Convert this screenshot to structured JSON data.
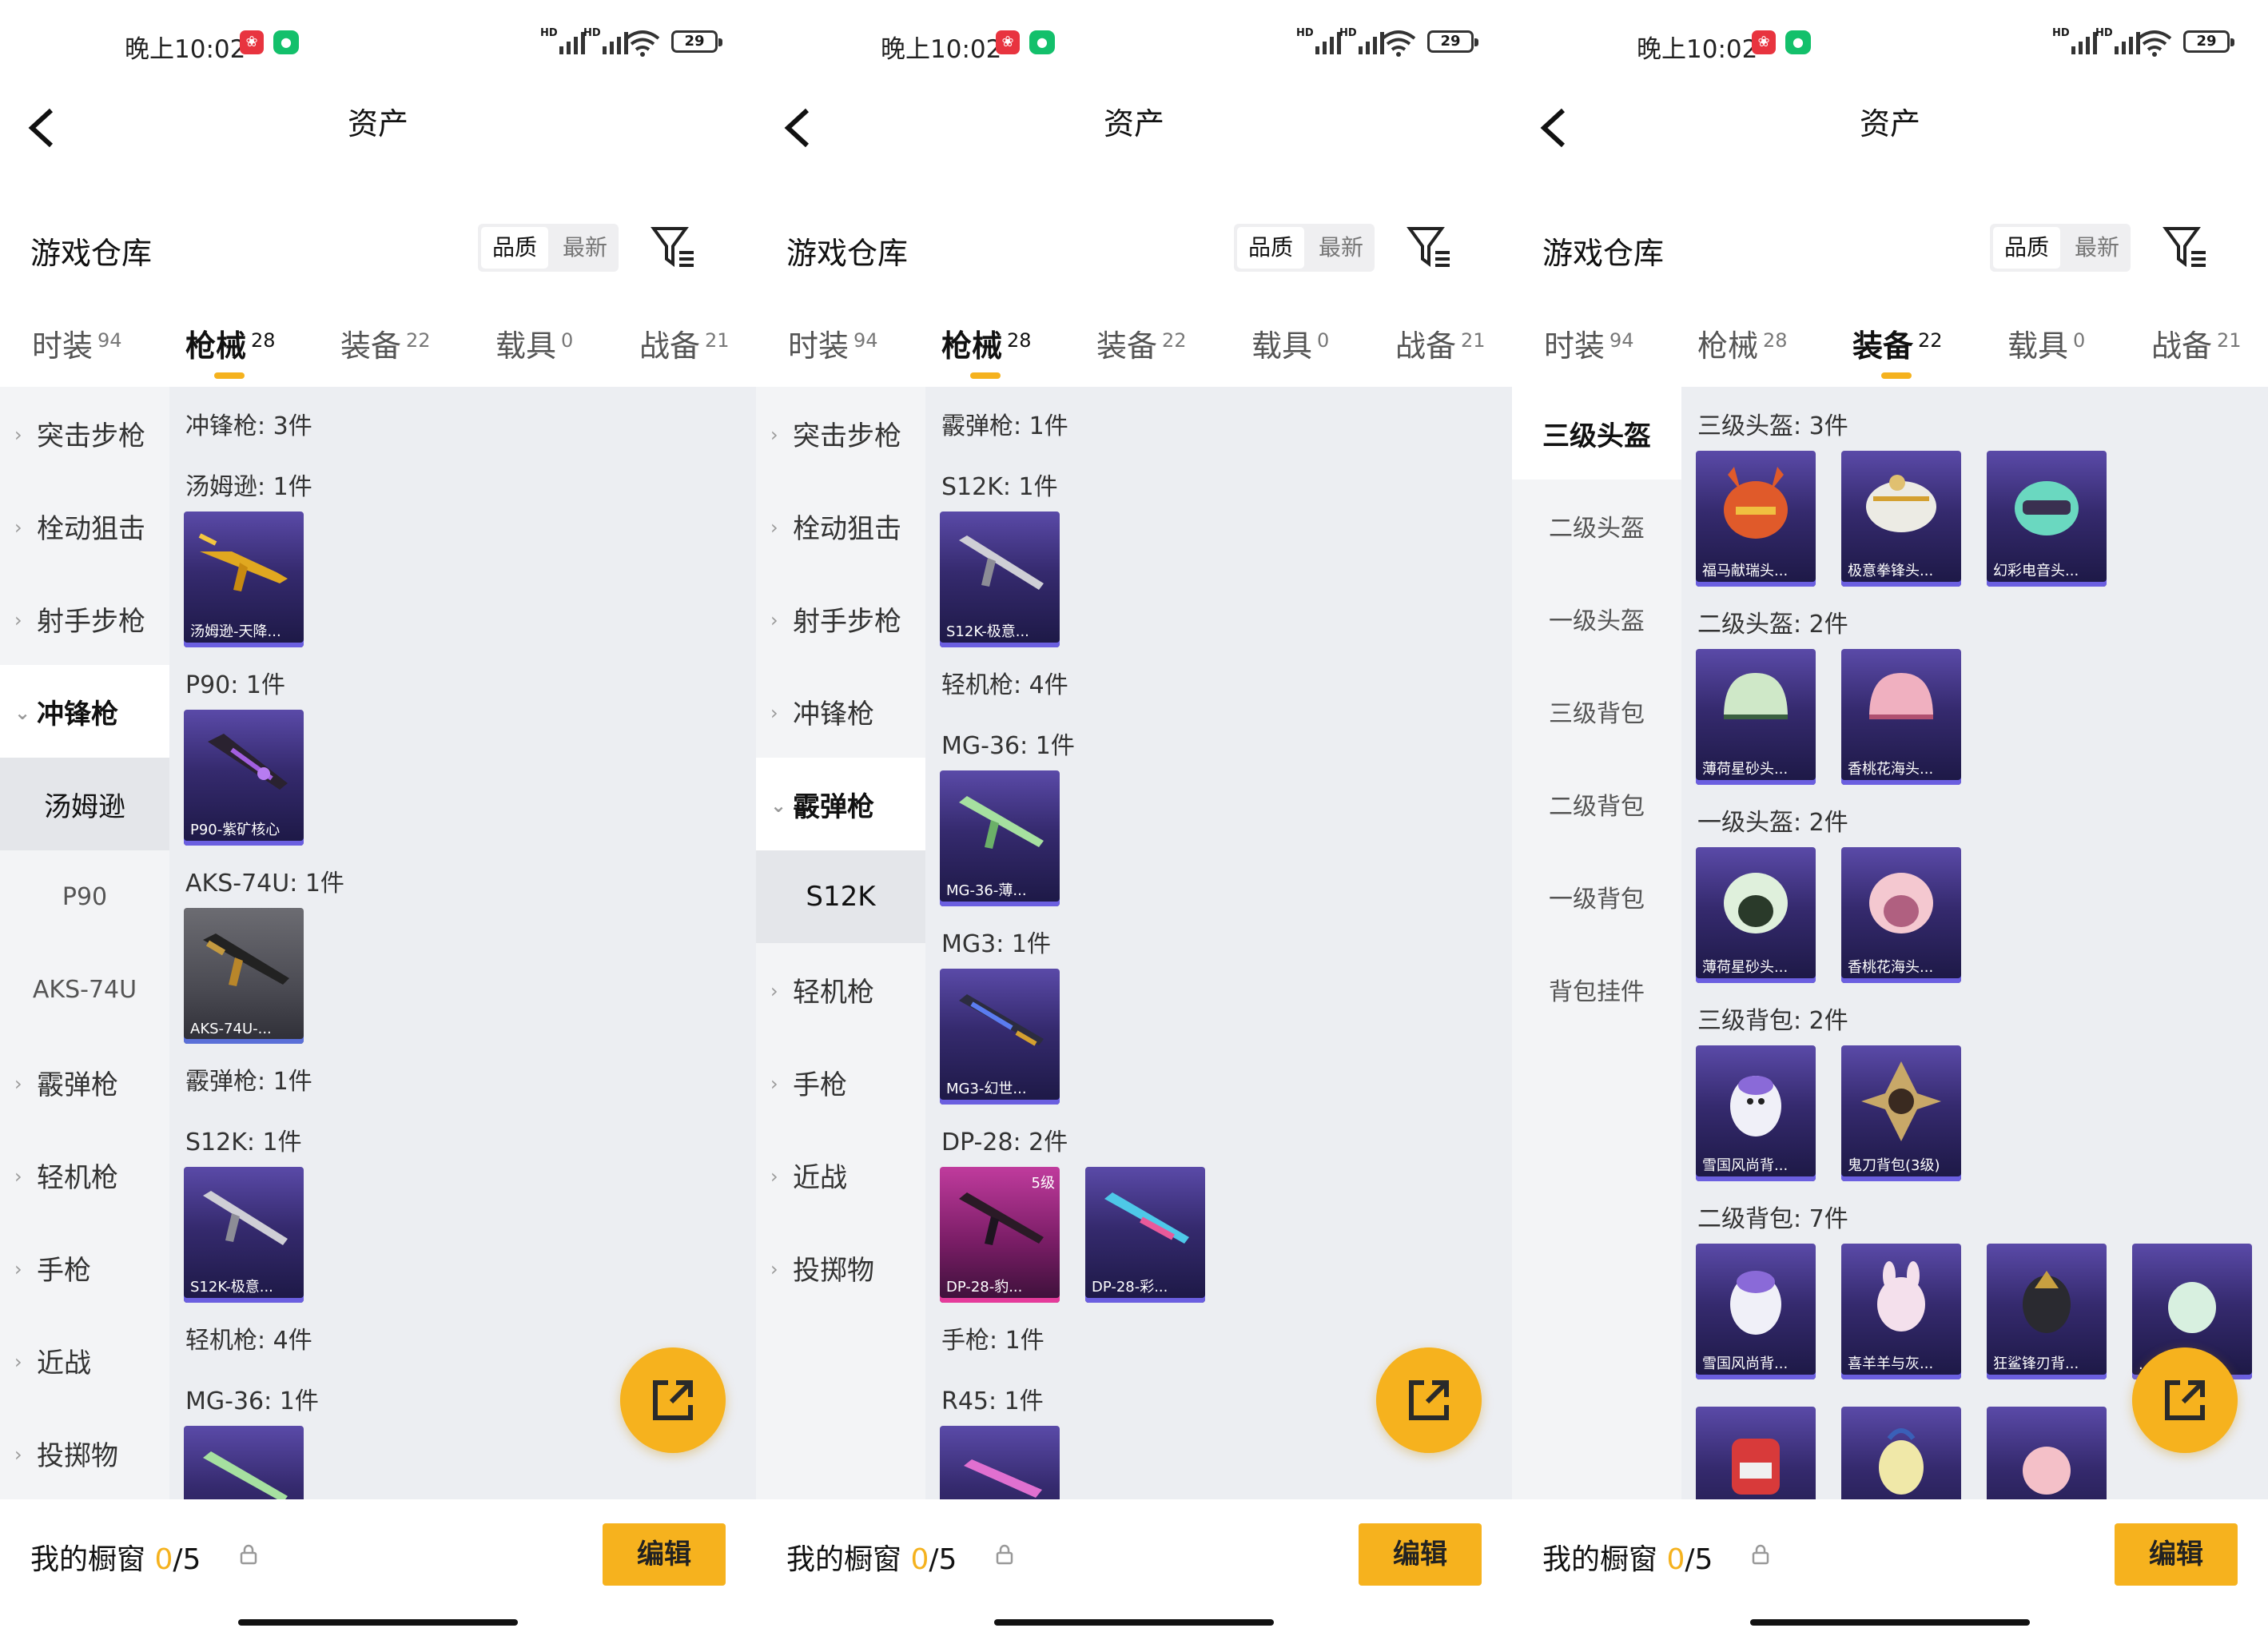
{
  "colors": {
    "accent": "#f6b21e",
    "card_purple": "#352a6e",
    "card_gray": "#4a4a52",
    "card_pink": "#7a1d66",
    "content_bg": "#eceef2"
  },
  "icons": [
    "back-arrow-icon",
    "filter-icon",
    "share-external-icon",
    "lock-icon",
    "wifi-icon",
    "signal-icon",
    "battery-icon",
    "chevron-right-icon",
    "chevron-down-icon"
  ],
  "panels": [
    {
      "status": {
        "time": "晚上10:02",
        "battery": "29",
        "hd1": "HD",
        "hd2": "HD"
      },
      "title": "资产",
      "warehouse": "游戏仓库",
      "sort": [
        "品质",
        "最新"
      ],
      "tabs": [
        {
          "label": "时装",
          "count": "94"
        },
        {
          "label": "枪械",
          "count": "28"
        },
        {
          "label": "装备",
          "count": "22"
        },
        {
          "label": "载具",
          "count": "0"
        },
        {
          "label": "战备",
          "count": "21"
        }
      ],
      "side": [
        "突击步枪",
        "栓动狙击",
        "射手步枪",
        "冲锋枪",
        "汤姆逊",
        "P90",
        "AKS-74U",
        "霰弹枪",
        "轻机枪",
        "手枪",
        "近战",
        "投掷物"
      ],
      "sections": [
        "冲锋枪: 3件",
        "汤姆逊: 1件",
        "P90: 1件",
        "AKS-74U: 1件",
        "霰弹枪: 1件",
        "S12K: 1件",
        "轻机枪: 4件",
        "MG-36: 1件"
      ],
      "cards": [
        "汤姆逊-天降...",
        "P90-紫矿核心",
        "AKS-74U-...",
        "S12K-极意...",
        ""
      ],
      "bottom": {
        "label": "我的橱窗",
        "zero": "0",
        "total": "/5",
        "edit": "编辑"
      }
    },
    {
      "status": {
        "time": "晚上10:02",
        "battery": "29",
        "hd1": "HD",
        "hd2": "HD"
      },
      "title": "资产",
      "warehouse": "游戏仓库",
      "sort": [
        "品质",
        "最新"
      ],
      "tabs": [
        {
          "label": "时装",
          "count": "94"
        },
        {
          "label": "枪械",
          "count": "28"
        },
        {
          "label": "装备",
          "count": "22"
        },
        {
          "label": "载具",
          "count": "0"
        },
        {
          "label": "战备",
          "count": "21"
        }
      ],
      "side": [
        "突击步枪",
        "栓动狙击",
        "射手步枪",
        "冲锋枪",
        "霰弹枪",
        "S12K",
        "轻机枪",
        "手枪",
        "近战",
        "投掷物"
      ],
      "sections": [
        "霰弹枪: 1件",
        "S12K: 1件",
        "轻机枪: 4件",
        "MG-36: 1件",
        "MG3: 1件",
        "DP-28: 2件",
        "手枪: 1件",
        "R45: 1件"
      ],
      "cards": [
        "S12K-极意...",
        "MG-36-薄...",
        "MG3-幻世...",
        "DP-28-豹...",
        "DP-28-彩...",
        ""
      ],
      "level_badge": "5级",
      "bottom": {
        "label": "我的橱窗",
        "zero": "0",
        "total": "/5",
        "edit": "编辑"
      }
    },
    {
      "status": {
        "time": "晚上10:02",
        "battery": "29",
        "hd1": "HD",
        "hd2": "HD"
      },
      "title": "资产",
      "warehouse": "游戏仓库",
      "sort": [
        "品质",
        "最新"
      ],
      "tabs": [
        {
          "label": "时装",
          "count": "94"
        },
        {
          "label": "枪械",
          "count": "28"
        },
        {
          "label": "装备",
          "count": "22"
        },
        {
          "label": "载具",
          "count": "0"
        },
        {
          "label": "战备",
          "count": "21"
        }
      ],
      "side": [
        "三级头盔",
        "二级头盔",
        "一级头盔",
        "三级背包",
        "二级背包",
        "一级背包",
        "背包挂件"
      ],
      "sections": [
        "三级头盔: 3件",
        "二级头盔: 2件",
        "一级头盔: 2件",
        "三级背包: 2件",
        "二级背包: 7件"
      ],
      "cards": [
        "福马献瑞头...",
        "极意拳锋头...",
        "幻彩电音头...",
        "薄荷星砂头...",
        "香桃花海头...",
        "薄荷星砂头...",
        "香桃花海头...",
        "雪国风尚背...",
        "鬼刀背包(3级)",
        "雪国风尚背...",
        "喜羊羊与灰...",
        "狂鲨锋刃背...",
        "...",
        "",
        "",
        ""
      ],
      "bottom": {
        "label": "我的橱窗",
        "zero": "0",
        "total": "/5",
        "edit": "编辑"
      }
    }
  ]
}
